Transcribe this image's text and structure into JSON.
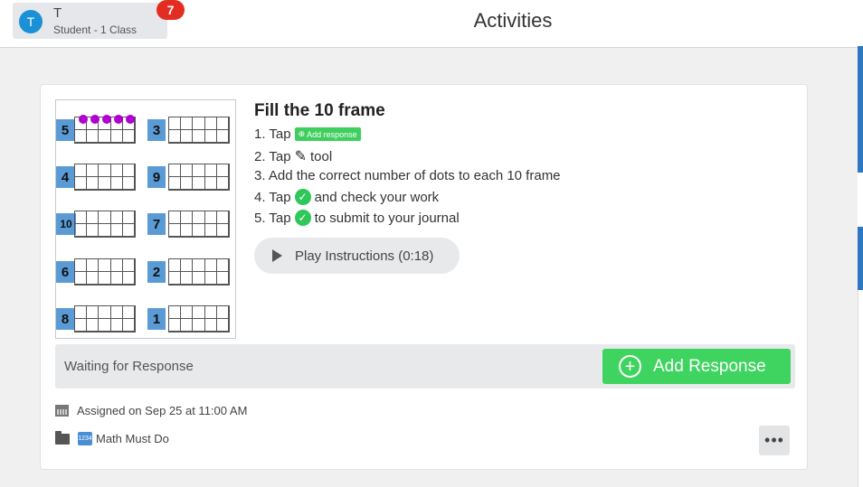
{
  "header": {
    "user_initial": "T",
    "user_name": "T",
    "user_role": "Student - 1 Class",
    "notification_count": "7",
    "title": "Activities"
  },
  "activity": {
    "title": "Fill the 10 frame",
    "steps": [
      {
        "prefix": "1. Tap",
        "suffix": ""
      },
      {
        "prefix": "2. Tap",
        "suffix": "tool"
      },
      {
        "prefix": "3. Add the correct number of dots to each 10 frame",
        "suffix": ""
      },
      {
        "prefix": "4. Tap",
        "suffix": "and check your work"
      },
      {
        "prefix": "5. Tap",
        "suffix": "to submit to your journal"
      }
    ],
    "mini_add_label": "Add response",
    "play_label": "Play Instructions (0:18)",
    "thumbnail_numbers": [
      "5",
      "3",
      "4",
      "9",
      "10",
      "7",
      "6",
      "2",
      "8",
      "1"
    ],
    "thumbnail_dots_on_first": 5
  },
  "response": {
    "status": "Waiting for Response",
    "add_label": "Add Response"
  },
  "meta": {
    "assigned": "Assigned on Sep 25 at 11:00 AM",
    "folder_emoji_text": "1234",
    "folder": "Math Must Do",
    "more": "•••"
  },
  "colors": {
    "accent_green": "#3ed45f",
    "badge_red": "#e32c22",
    "avatar_blue": "#1a90d6"
  }
}
